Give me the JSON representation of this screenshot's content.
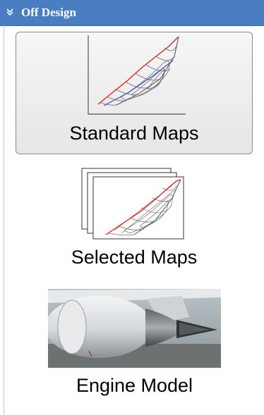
{
  "panel": {
    "title": "Off Design",
    "collapse_icon": "double-chevron-icon"
  },
  "items": [
    {
      "label": "Standard Maps",
      "icon": "compressor-map-icon",
      "selected": true
    },
    {
      "label": "Selected Maps",
      "icon": "stacked-maps-icon",
      "selected": false
    },
    {
      "label": "Engine Model",
      "icon": "engine-photo",
      "selected": false
    }
  ],
  "colors": {
    "header_bg": "#4a7ec2",
    "surge_line": "#e02020",
    "operating_line": "#3050d0",
    "map_lines": "#606060"
  }
}
